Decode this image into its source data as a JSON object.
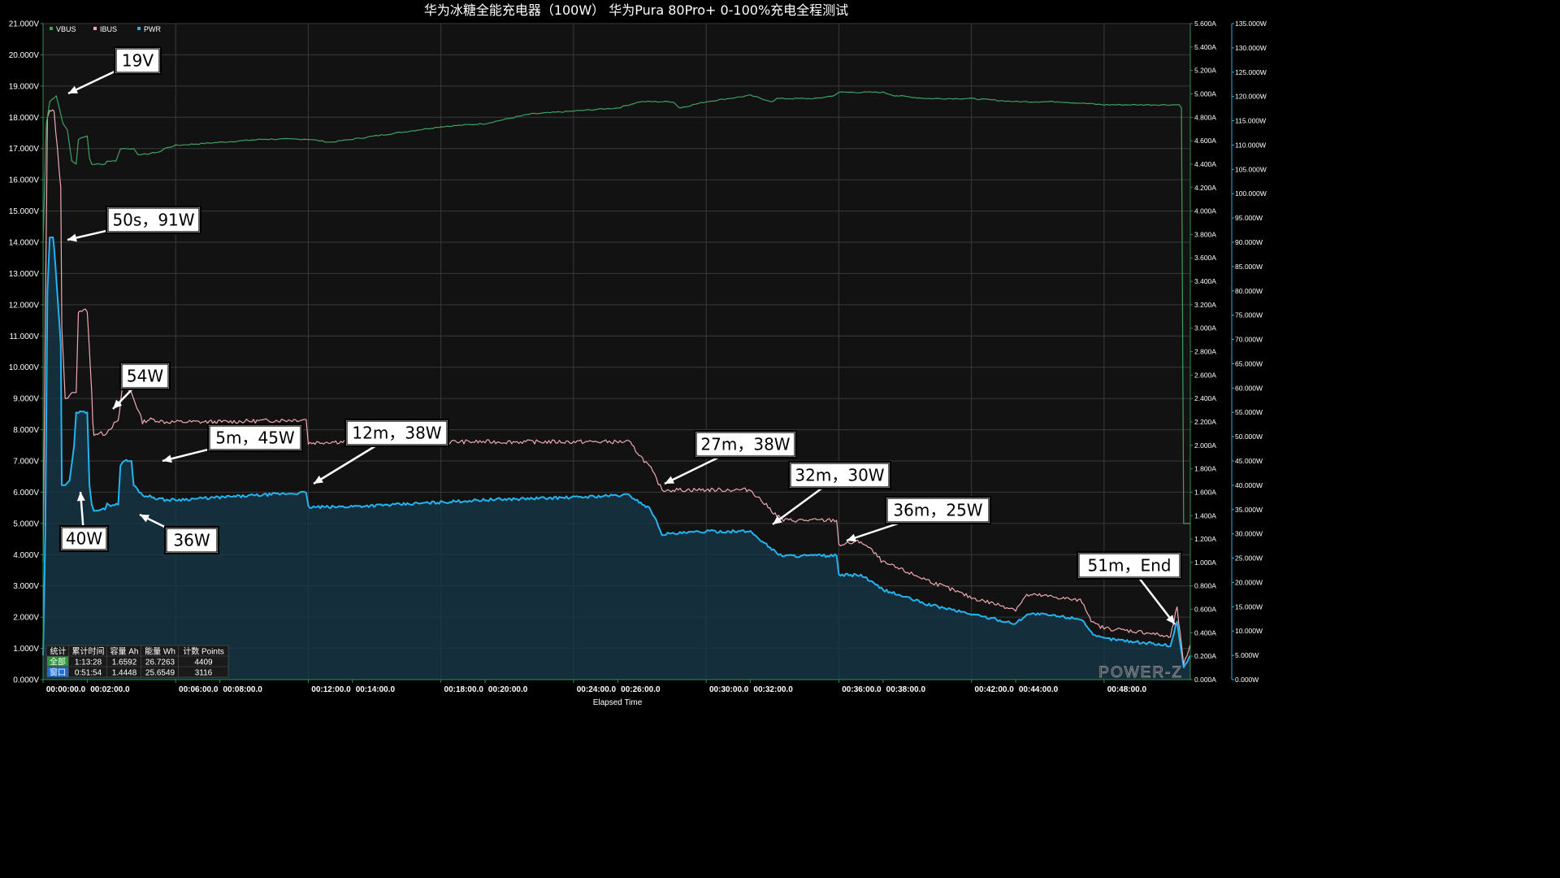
{
  "chart_data": {
    "type": "line",
    "title": "华为冰糖全能充电器（100W） 华为Pura 80Pro+  0-100%充电全程测试",
    "xlabel": "Elapsed Time",
    "x_ticks": [
      "00:00:00.0",
      "00:02:00.0",
      "00:06:00.0",
      "00:08:00.0",
      "00:12:00.0",
      "00:14:00.0",
      "00:18:00.0",
      "00:20:00.0",
      "00:24:00.0",
      "00:26:00.0",
      "00:30:00.0",
      "00:32:00.0",
      "00:36:00.0",
      "00:38:00.0",
      "00:42:00.0",
      "00:44:00.0",
      "00:48:00.0"
    ],
    "x_tick_minutes": [
      0,
      2,
      6,
      8,
      12,
      14,
      18,
      20,
      24,
      26,
      30,
      32,
      36,
      38,
      42,
      44,
      48
    ],
    "xlim_minutes": [
      0,
      51.9
    ],
    "grid": true,
    "legend_position": "top-left",
    "axes": {
      "vbus": {
        "side": "left",
        "range": [
          0,
          21
        ],
        "ticks": [
          "0.000V",
          "1.000V",
          "2.000V",
          "3.000V",
          "4.000V",
          "5.000V",
          "6.000V",
          "7.000V",
          "8.000V",
          "9.000V",
          "10.000V",
          "11.000V",
          "12.000V",
          "13.000V",
          "14.000V",
          "15.000V",
          "16.000V",
          "17.000V",
          "18.000V",
          "19.000V",
          "20.000V",
          "21.000V"
        ]
      },
      "ibus": {
        "side": "right",
        "range": [
          0,
          5.6
        ],
        "ticks": [
          "0.000A",
          "0.200A",
          "0.400A",
          "0.600A",
          "0.800A",
          "1.000A",
          "1.200A",
          "1.400A",
          "1.600A",
          "1.800A",
          "2.000A",
          "2.200A",
          "2.400A",
          "2.600A",
          "2.800A",
          "3.000A",
          "3.200A",
          "3.400A",
          "3.600A",
          "3.800A",
          "4.000A",
          "4.200A",
          "4.400A",
          "4.600A",
          "4.800A",
          "5.000A",
          "5.200A",
          "5.400A",
          "5.600A"
        ]
      },
      "pwr": {
        "side": "right",
        "range": [
          0,
          135
        ],
        "ticks": [
          "0.000W",
          "5.000W",
          "10.000W",
          "15.000W",
          "20.000W",
          "25.000W",
          "30.000W",
          "35.000W",
          "40.000W",
          "45.000W",
          "50.000W",
          "55.000W",
          "60.000W",
          "65.000W",
          "70.000W",
          "75.000W",
          "80.000W",
          "85.000W",
          "90.000W",
          "95.000W",
          "100.000W",
          "105.000W",
          "110.000W",
          "115.000W",
          "120.000W",
          "125.000W",
          "130.000W",
          "135.000W"
        ]
      }
    },
    "series": [
      {
        "name": "VBUS",
        "axis": "vbus",
        "color": "#3fa060",
        "x": [
          0,
          0.15,
          0.3,
          0.6,
          0.9,
          1.1,
          1.3,
          1.5,
          1.6,
          2.0,
          2.1,
          2.2,
          2.8,
          2.9,
          3.3,
          3.5,
          4.1,
          4.3,
          4.5,
          5.3,
          5.5,
          6,
          8,
          10,
          12,
          13,
          14,
          16,
          18,
          20,
          22,
          24,
          26,
          27,
          28.5,
          28.8,
          30,
          32,
          33,
          33.2,
          35,
          35.8,
          36,
          38,
          38.5,
          40,
          42,
          44,
          46,
          48,
          50,
          51.4,
          51.5,
          51.6,
          51.9
        ],
        "y": [
          14.0,
          17.8,
          18.5,
          18.7,
          17.8,
          17.6,
          16.6,
          16.5,
          17.3,
          17.4,
          16.7,
          16.5,
          16.5,
          16.6,
          16.6,
          17.0,
          17.0,
          16.8,
          16.8,
          16.9,
          17.0,
          17.1,
          17.2,
          17.3,
          17.3,
          17.2,
          17.3,
          17.5,
          17.7,
          17.8,
          18.1,
          18.2,
          18.3,
          18.5,
          18.5,
          18.3,
          18.5,
          18.7,
          18.5,
          18.6,
          18.6,
          18.7,
          18.8,
          18.8,
          18.7,
          18.6,
          18.6,
          18.5,
          18.5,
          18.4,
          18.4,
          18.4,
          18.3,
          5.0,
          5.0
        ]
      },
      {
        "name": "IBUS",
        "axis": "ibus",
        "color": "#f0a8b0",
        "x": [
          0,
          0.1,
          0.2,
          0.3,
          0.5,
          0.8,
          0.85,
          1.0,
          1.1,
          1.3,
          1.5,
          1.6,
          2.0,
          2.2,
          2.25,
          2.3,
          2.8,
          3.3,
          3.4,
          3.6,
          4.0,
          4.5,
          4.8,
          5.0,
          5.5,
          6,
          8,
          10,
          11.9,
          12.0,
          13,
          16,
          20,
          24,
          26.5,
          27.5,
          28.0,
          28.5,
          30,
          32,
          33.2,
          33.5,
          35,
          35.9,
          36,
          37,
          37.5,
          38,
          40,
          42,
          44,
          44.5,
          45,
          46,
          47,
          47.5,
          48,
          50,
          51,
          51.3,
          51.6,
          51.9
        ],
        "y": [
          1.0,
          3.0,
          4.8,
          4.85,
          4.85,
          4.2,
          3.0,
          2.4,
          2.4,
          2.45,
          2.45,
          3.15,
          3.15,
          2.45,
          2.2,
          2.1,
          2.1,
          2.2,
          2.2,
          2.5,
          2.45,
          2.2,
          2.22,
          2.22,
          2.2,
          2.2,
          2.2,
          2.21,
          2.22,
          2.02,
          2.03,
          2.03,
          2.03,
          2.03,
          2.03,
          1.8,
          1.62,
          1.62,
          1.62,
          1.62,
          1.4,
          1.36,
          1.36,
          1.36,
          1.15,
          1.18,
          1.1,
          1.0,
          0.85,
          0.7,
          0.6,
          0.72,
          0.72,
          0.7,
          0.67,
          0.48,
          0.44,
          0.4,
          0.36,
          0.62,
          0.12,
          0.3
        ]
      },
      {
        "name": "PWR",
        "axis": "pwr",
        "color": "#22b4f0",
        "x": [
          0,
          0.1,
          0.2,
          0.3,
          0.45,
          0.5,
          0.8,
          0.85,
          1.0,
          1.2,
          1.4,
          1.5,
          1.6,
          2.0,
          2.1,
          2.2,
          2.3,
          2.8,
          2.9,
          3.4,
          3.5,
          3.6,
          4.0,
          4.1,
          4.5,
          5.0,
          5.5,
          6,
          8,
          10,
          11.9,
          12.0,
          13,
          16,
          20,
          24,
          26.5,
          27.5,
          28.0,
          28.5,
          30,
          32,
          33.2,
          33.5,
          35,
          35.9,
          36,
          37,
          37.5,
          38,
          40,
          42,
          44,
          44.5,
          45,
          46,
          47,
          47.5,
          48,
          50,
          51,
          51.3,
          51.6,
          51.9
        ],
        "y": [
          5,
          30,
          80,
          91,
          91,
          89,
          69,
          40,
          40,
          41,
          48,
          55,
          55,
          55,
          40,
          36,
          35,
          35,
          36,
          36,
          44,
          45,
          45,
          40,
          38,
          37.5,
          37,
          37,
          37.5,
          38,
          38.5,
          35.5,
          35.5,
          36,
          37,
          37.5,
          38,
          35,
          30,
          30,
          30.5,
          30.5,
          26,
          25.5,
          25.5,
          25.5,
          21.5,
          21.5,
          20,
          18.5,
          15.5,
          13.5,
          11.5,
          13.5,
          13.5,
          13,
          12.5,
          9,
          8.5,
          7.5,
          7,
          12,
          2.5,
          5
        ]
      }
    ],
    "annotations": [
      {
        "text": "19V",
        "series": "VBUS",
        "x": 0.55,
        "y": 18.7
      },
      {
        "text": "50s，91W",
        "series": "PWR",
        "x": 0.6,
        "y": 91
      },
      {
        "text": "54W",
        "series": "IBUS",
        "x": 3.2,
        "y": 2.2
      },
      {
        "text": "5m，45W",
        "series": "PWR",
        "x": 5.2,
        "y": 43
      },
      {
        "text": "12m，38W",
        "series": "PWR",
        "x": 12.2,
        "y": 36.3
      },
      {
        "text": "27m，38W",
        "series": "PWR",
        "x": 28.3,
        "y": 39.5
      },
      {
        "text": "32m，30W",
        "series": "PWR",
        "x": 33.6,
        "y": 31.5
      },
      {
        "text": "36m，25W",
        "series": "PWR",
        "x": 36.2,
        "y": 28.5
      },
      {
        "text": "40W",
        "series": "PWR",
        "x": 1.5,
        "y": 37
      },
      {
        "text": "36W",
        "series": "PWR",
        "x": 4.5,
        "y": 34
      },
      {
        "text": "51m，End",
        "series": "PWR",
        "x": 51.0,
        "y": 11.5
      }
    ]
  },
  "legend": [
    {
      "label": "VBUS",
      "color": "#3fa060"
    },
    {
      "label": "IBUS",
      "color": "#f0a8b0"
    },
    {
      "label": "PWR",
      "color": "#22b4f0"
    }
  ],
  "stats": {
    "headers": [
      "统计",
      "累计时间",
      "容量 Ah",
      "能量 Wh",
      "计数 Points"
    ],
    "rows": [
      {
        "label": "全部",
        "color": "#2c9a3c",
        "values": [
          "1:13:28",
          "1.6592",
          "26.7263",
          "4409"
        ]
      },
      {
        "label": "窗口",
        "color": "#1f6fd0",
        "values": [
          "0:51:54",
          "1.4448",
          "25.6549",
          "3116"
        ]
      }
    ]
  },
  "brand": "POWER-Z"
}
